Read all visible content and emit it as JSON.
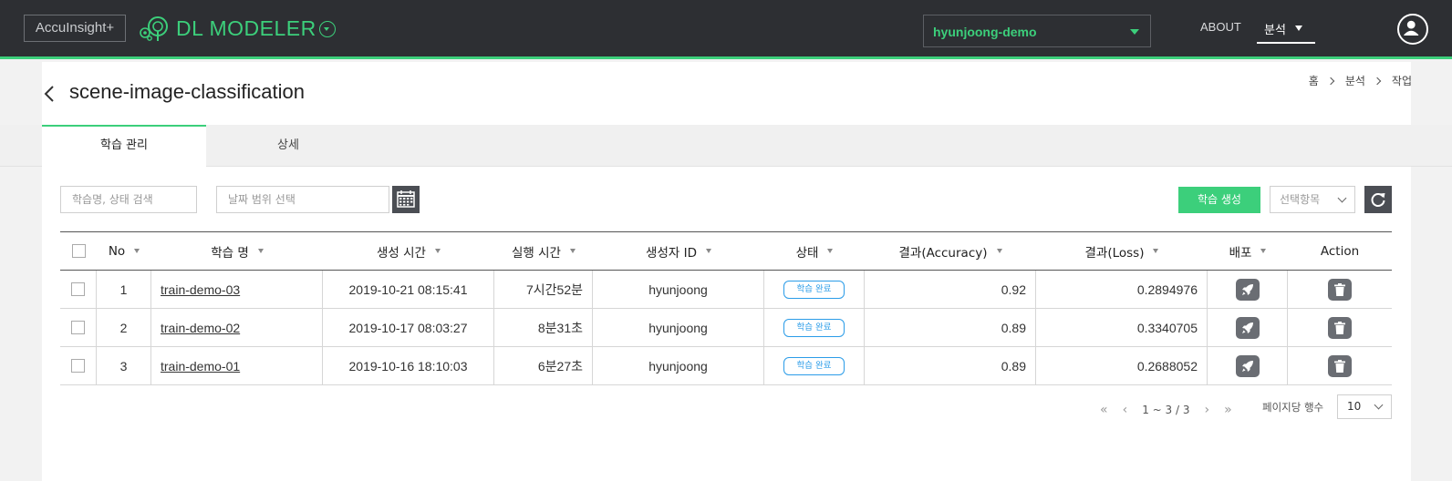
{
  "header": {
    "brand_label": "AccuInsight+",
    "product_name": "DL MODELER",
    "project": "hyunjoong-demo",
    "nav_about": "ABOUT",
    "nav_analysis": "분석"
  },
  "page": {
    "title": "scene-image-classification",
    "breadcrumb": [
      "홈",
      "분석",
      "작업"
    ]
  },
  "tabs": [
    {
      "label": "학습 관리",
      "active": true
    },
    {
      "label": "상세",
      "active": false
    }
  ],
  "toolbar": {
    "search_placeholder": "학습명, 상태 검색",
    "date_placeholder": "날짜 범위 선택",
    "create_label": "학습 생성",
    "select_placeholder": "선택항목"
  },
  "table": {
    "headers": [
      "No",
      "학습 명",
      "생성 시간",
      "실행 시간",
      "생성자 ID",
      "상태",
      "결과(Accuracy)",
      "결과(Loss)",
      "배포",
      "Action"
    ],
    "rows": [
      {
        "no": "1",
        "name": "train-demo-03",
        "created": "2019-10-21 08:15:41",
        "duration": "7시간52분",
        "creator": "hyunjoong",
        "status": "학습 완료",
        "accuracy": "0.92",
        "loss": "0.2894976"
      },
      {
        "no": "2",
        "name": "train-demo-02",
        "created": "2019-10-17 08:03:27",
        "duration": "8분31초",
        "creator": "hyunjoong",
        "status": "학습 완료",
        "accuracy": "0.89",
        "loss": "0.3340705"
      },
      {
        "no": "3",
        "name": "train-demo-01",
        "created": "2019-10-16 18:10:03",
        "duration": "6분27초",
        "creator": "hyunjoong",
        "status": "학습 완료",
        "accuracy": "0.89",
        "loss": "0.2688052"
      }
    ]
  },
  "pagination": {
    "range": "1 ~ 3 / 3",
    "per_page_label": "페이지당 행수",
    "per_page": "10"
  },
  "colors": {
    "accent": "#3ccf7b",
    "topbar": "#2d2f33",
    "badge": "#2b9ce8"
  }
}
